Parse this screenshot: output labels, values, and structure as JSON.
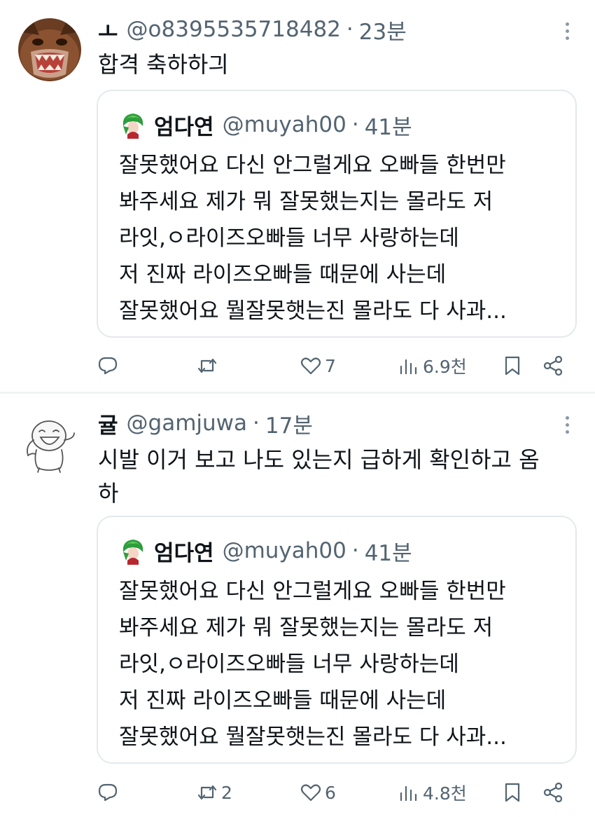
{
  "posts": [
    {
      "author_name": "ㅗ",
      "handle": "@o8395535718482",
      "separator": "·",
      "time": "23분",
      "text_lines": [
        "합격 축하하긔"
      ],
      "quote": {
        "name": "엄다연",
        "handle": "@muyah00",
        "separator": "·",
        "time": "41분",
        "lines": [
          "잘못했어요 다신 안그럴게요 오빠들 한번만",
          "봐주세요 제가 뭐 잘못했는지는 몰라도 저",
          "라잇,ㅇ라이즈오빠들 너무 사랑하는데",
          "저 진짜 라이즈오빠들 때문에 사는데",
          "잘못했어요 뭘잘못햇는진 몰라도 다 사과..."
        ]
      },
      "stats": {
        "replies": "",
        "reposts": "",
        "likes": "7",
        "views": "6.9천"
      }
    },
    {
      "author_name": "귤",
      "handle": "@gamjuwa",
      "separator": "·",
      "time": "17분",
      "text_lines": [
        "시발 이거 보고 나도 있는지 급하게 확인하고 옴",
        "하"
      ],
      "quote": {
        "name": "엄다연",
        "handle": "@muyah00",
        "separator": "·",
        "time": "41분",
        "lines": [
          "잘못했어요 다신 안그럴게요 오빠들 한번만",
          "봐주세요 제가 뭐 잘못했는지는 몰라도 저",
          "라잇,ㅇ라이즈오빠들 너무 사랑하는데",
          "저 진짜 라이즈오빠들 때문에 사는데",
          "잘못했어요 뭘잘못햇는진 몰라도 다 사과..."
        ]
      },
      "stats": {
        "replies": "",
        "reposts": "2",
        "likes": "6",
        "views": "4.8천"
      }
    }
  ],
  "icons": {
    "more": "more-vertical-icon",
    "reply": "reply-icon",
    "repost": "repost-icon",
    "like": "heart-icon",
    "views": "views-icon",
    "bookmark": "bookmark-icon",
    "share": "share-icon"
  },
  "colors": {
    "text": "#0f1419",
    "secondary": "#536471",
    "border": "#e4e9ec",
    "divider": "#eff3f4"
  }
}
